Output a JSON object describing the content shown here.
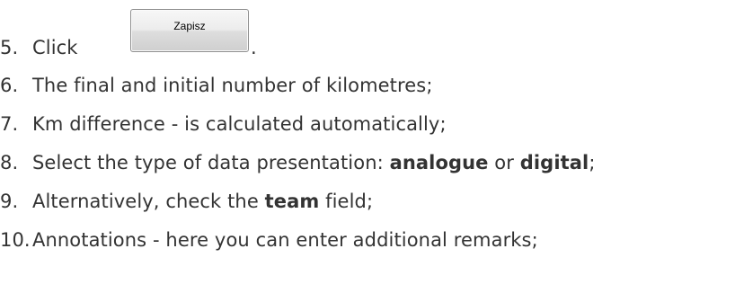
{
  "steps": [
    {
      "number": "5.",
      "text": "Click"
    },
    {
      "number": "6.",
      "text": "The final and initial number of kilometres;"
    },
    {
      "number": "7.",
      "text": "Km difference - is calculated automatically;"
    },
    {
      "number": "8.",
      "pre": "Select the type of data presentation: ",
      "bold1": "analogue",
      "mid": " or ",
      "bold2": "digital",
      "post": ";"
    },
    {
      "number": "9.",
      "pre": "Alternatively, check the ",
      "bold1": "team",
      "post": " field;"
    },
    {
      "number": "10.",
      "text": "Annotations - here you can enter additional remarks;"
    }
  ],
  "save_button": {
    "label": "Zapisz"
  },
  "step5_suffix": "."
}
